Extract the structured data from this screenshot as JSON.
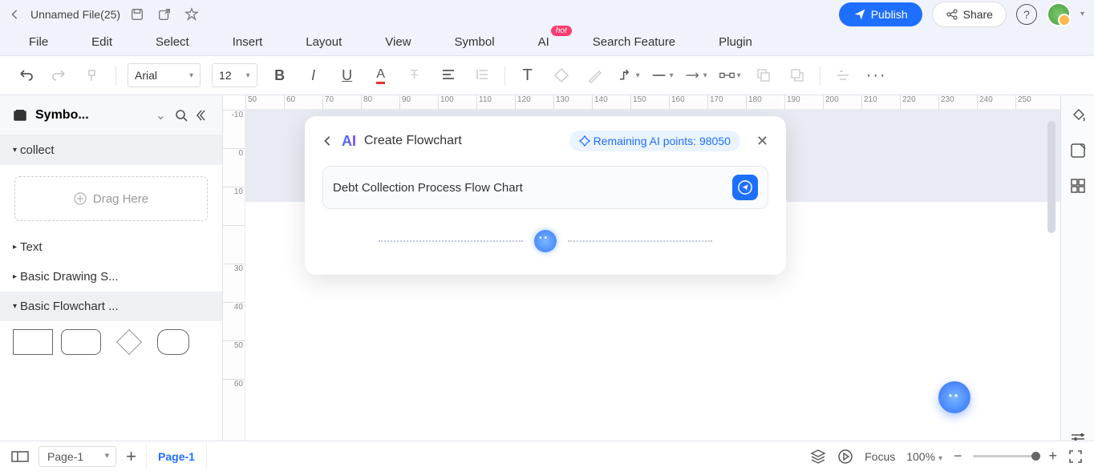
{
  "titlebar": {
    "filename": "Unnamed File(25)"
  },
  "actions": {
    "publish": "Publish",
    "share": "Share"
  },
  "menu": {
    "file": "File",
    "edit": "Edit",
    "select": "Select",
    "insert": "Insert",
    "layout": "Layout",
    "view": "View",
    "symbol": "Symbol",
    "ai": "AI",
    "hot": "hot",
    "search_feature": "Search Feature",
    "plugin": "Plugin"
  },
  "toolbar": {
    "font": "Arial",
    "size": "12"
  },
  "sidebar": {
    "title": "Symbo...",
    "collect": "collect",
    "drag_here": "Drag Here",
    "text": "Text",
    "basic_drawing": "Basic Drawing S...",
    "basic_flowchart": "Basic Flowchart ..."
  },
  "ruler_h": [
    "50",
    "60",
    "70",
    "80",
    "90",
    "100",
    "110",
    "120",
    "130",
    "140",
    "150",
    "160",
    "170",
    "180",
    "190",
    "200",
    "210",
    "220",
    "230",
    "240",
    "250"
  ],
  "ruler_v": [
    "-10",
    "0",
    "10",
    "",
    "30",
    "40",
    "50",
    "60"
  ],
  "ai_panel": {
    "title": "Create Flowchart",
    "points_label": "Remaining AI points:",
    "points_value": "98050",
    "input_value": "Debt Collection Process Flow Chart"
  },
  "bottombar": {
    "page_select": "Page-1",
    "page_tab": "Page-1",
    "focus": "Focus",
    "zoom": "100%"
  }
}
